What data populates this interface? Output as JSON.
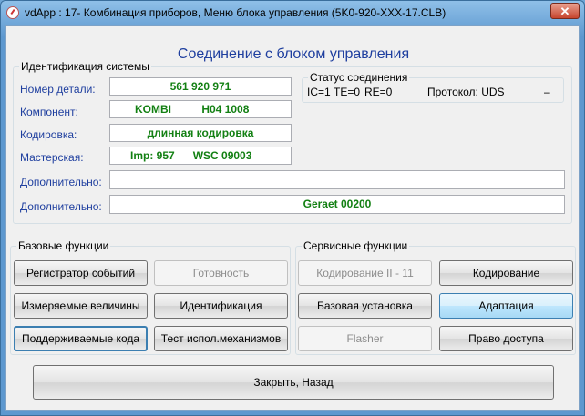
{
  "window": {
    "title": "vdApp : 17- Комбинация приборов,  Меню блока управления (5K0-920-XXX-17.CLB)",
    "close_glyph": "✕"
  },
  "heading": "Соединение с блоком управления",
  "identification": {
    "label": "Идентификация системы",
    "fields": [
      {
        "label": "Номер детали:",
        "value": "561 920 971"
      },
      {
        "label": "Компонент:",
        "value": "KOMBI          H04 1008"
      },
      {
        "label": "Кодировка:",
        "value": "длинная кодировка"
      },
      {
        "label": "Мастерская:",
        "value": "Imp: 957      WSC 09003"
      },
      {
        "label": "Дополнительно:",
        "value": ""
      },
      {
        "label": "Дополнительно:",
        "value": "Geraet 00200"
      }
    ]
  },
  "status": {
    "label": "Статус соединения",
    "ic": "IC=1",
    "te": "TE=0",
    "re": "RE=0",
    "protocol": "Протокол: UDS",
    "extra": "–"
  },
  "basic": {
    "label": "Базовые функции",
    "buttons": [
      {
        "label": "Регистратор событий",
        "state": "normal"
      },
      {
        "label": "Готовность",
        "state": "disabled"
      },
      {
        "label": "Измеряемые величины",
        "state": "normal"
      },
      {
        "label": "Идентификация",
        "state": "normal"
      },
      {
        "label": "Поддерживаемые кода",
        "state": "focused"
      },
      {
        "label": "Тест испол.механизмов",
        "state": "normal"
      }
    ]
  },
  "service": {
    "label": "Сервисные функции",
    "buttons": [
      {
        "label": "Кодирование II - 11",
        "state": "disabled"
      },
      {
        "label": "Кодирование",
        "state": "normal"
      },
      {
        "label": "Базовая установка",
        "state": "normal"
      },
      {
        "label": "Адаптация",
        "state": "active"
      },
      {
        "label": "Flasher",
        "state": "disabled"
      },
      {
        "label": "Право доступа",
        "state": "normal"
      }
    ]
  },
  "close_button": "Закрыть, Назад"
}
